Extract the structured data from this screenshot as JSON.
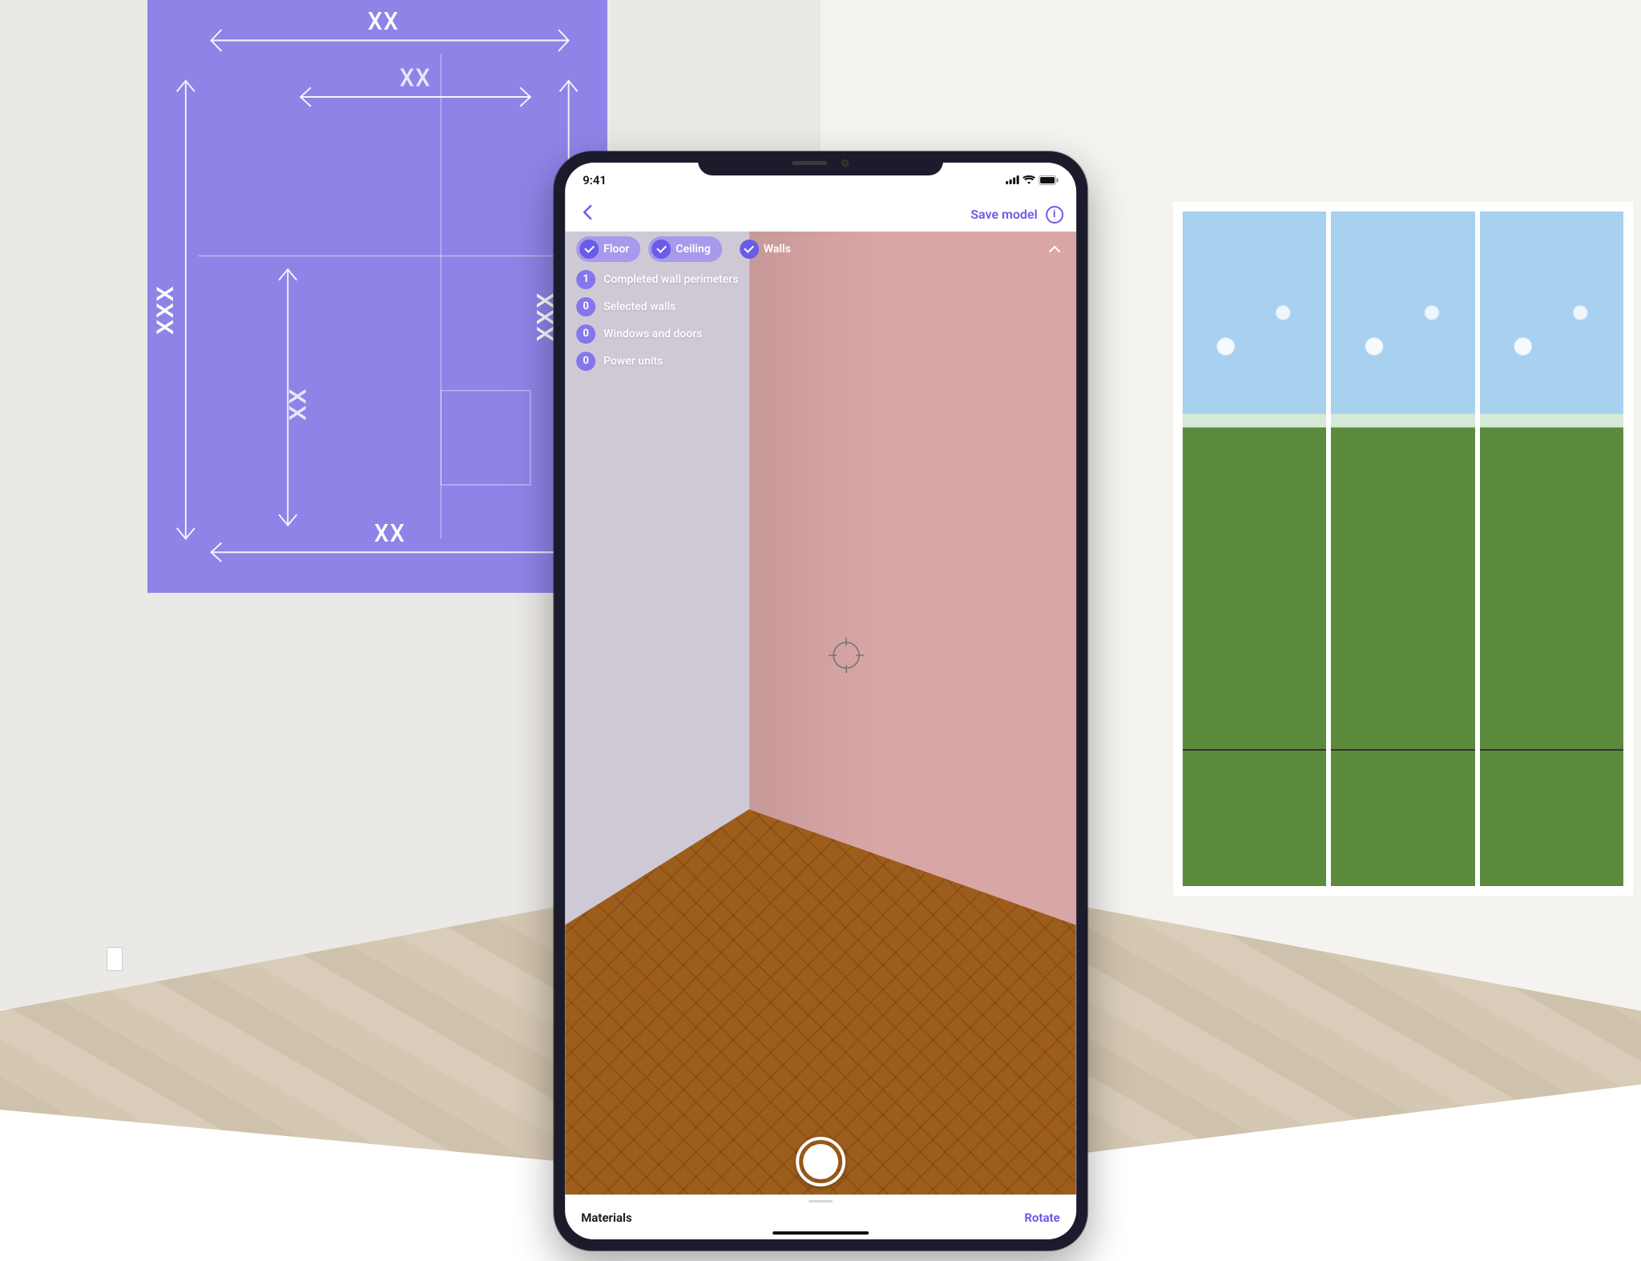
{
  "colors": {
    "accent": "#6b5ce7",
    "chip_bg": "#a091f0",
    "blueprint": "#6b5ce7"
  },
  "blueprint": {
    "labels": {
      "top": "XX",
      "top_inner": "XX",
      "left_outer": "XXX",
      "left_inner": "XX",
      "right": "XXX",
      "bottom": "XX"
    }
  },
  "phone": {
    "status": {
      "time": "9:41"
    },
    "nav": {
      "save_label": "Save model"
    },
    "chips": {
      "floor": "Floor",
      "ceiling": "Ceiling",
      "walls": "Walls"
    },
    "stats": [
      {
        "count": "1",
        "label": "Completed wall perimeters"
      },
      {
        "count": "0",
        "label": "Selected walls"
      },
      {
        "count": "0",
        "label": "Windows and doors"
      },
      {
        "count": "0",
        "label": "Power units"
      }
    ],
    "bottom": {
      "materials_label": "Materials",
      "rotate_label": "Rotate"
    }
  }
}
